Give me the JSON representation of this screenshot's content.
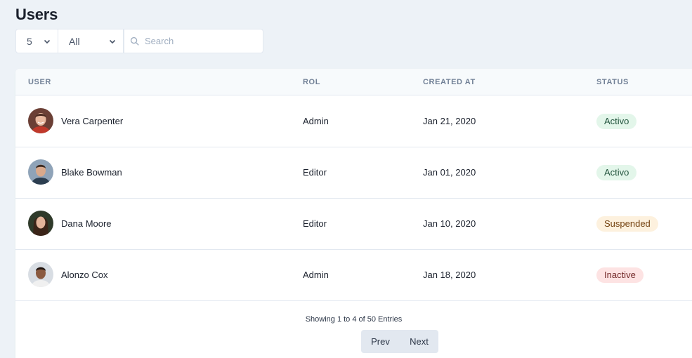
{
  "page": {
    "title": "Users"
  },
  "filters": {
    "per_page": "5",
    "role": "All",
    "search_placeholder": "Search",
    "search_value": ""
  },
  "table": {
    "columns": [
      "USER",
      "ROL",
      "CREATED AT",
      "STATUS"
    ],
    "rows": [
      {
        "name": "Vera Carpenter",
        "role": "Admin",
        "created": "Jan 21, 2020",
        "status": "Activo",
        "status_kind": "active"
      },
      {
        "name": "Blake Bowman",
        "role": "Editor",
        "created": "Jan 01, 2020",
        "status": "Activo",
        "status_kind": "active"
      },
      {
        "name": "Dana Moore",
        "role": "Editor",
        "created": "Jan 10, 2020",
        "status": "Suspended",
        "status_kind": "suspended"
      },
      {
        "name": "Alonzo Cox",
        "role": "Admin",
        "created": "Jan 18, 2020",
        "status": "Inactive",
        "status_kind": "inactive"
      }
    ]
  },
  "footer": {
    "showing": "Showing 1 to 4 of 50 Entries",
    "prev_label": "Prev",
    "next_label": "Next"
  },
  "colors": {
    "active_bg": "#e3f6ea",
    "active_fg": "#22543d",
    "suspended_bg": "#fdf1de",
    "suspended_fg": "#744210",
    "inactive_bg": "#fde3e3",
    "inactive_fg": "#742a2a"
  },
  "icons": {
    "search": "search-icon",
    "chevron": "chevron-down-icon",
    "avatar": "avatar-photo"
  }
}
